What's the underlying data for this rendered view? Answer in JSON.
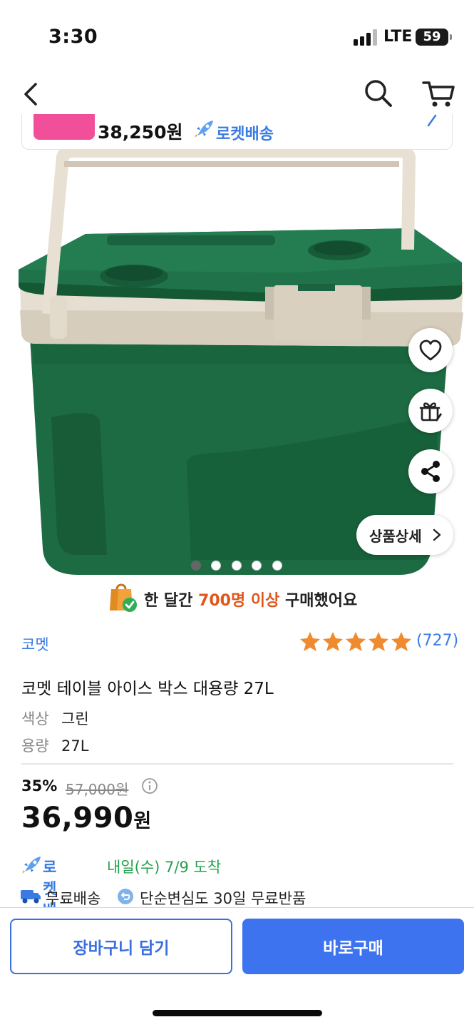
{
  "status_bar": {
    "time": "3:30",
    "network": "LTE",
    "battery": "59"
  },
  "nav": {
    "back_icon": "chevron-left-icon",
    "search_icon": "search-icon",
    "cart_icon": "cart-icon"
  },
  "summary": {
    "price": "38,250원",
    "delivery_badge": "로켓배송",
    "thumb_color": "#f24f9a"
  },
  "image": {
    "total_slides": 5,
    "active_slide": 1,
    "detail_button": "상품상세",
    "actions": [
      "heart-icon",
      "gift-icon",
      "share-icon"
    ]
  },
  "purchase_banner": {
    "prefix": "한 달간 ",
    "highlight": "700명 이상",
    "suffix": " 구매했어요"
  },
  "product": {
    "brand": "코멧",
    "rating_stars": 5,
    "review_count": "(727)",
    "title": "코멧 테이블 아이스 박스 대용량 27L",
    "options": [
      {
        "label": "색상",
        "value": "그린"
      },
      {
        "label": "용량",
        "value": "27L"
      }
    ]
  },
  "pricing": {
    "discount_rate": "35%",
    "original_price": "57,000원",
    "sale_price": "36,990",
    "sale_unit": "원"
  },
  "delivery": {
    "badge": "로켓배송",
    "arrival": "내일(수) 7/9 도착",
    "free_shipping": "무료배송",
    "free_return": "단순변심도 30일 무료반품"
  },
  "actions": {
    "add_to_cart": "장바구니 담기",
    "buy_now": "바로구매"
  },
  "colors": {
    "accent_blue": "#3e73f0",
    "link_blue": "#3a7be3",
    "highlight_orange": "#e0571b",
    "arrival_green": "#23a14d",
    "star_orange": "#f08a2e"
  }
}
